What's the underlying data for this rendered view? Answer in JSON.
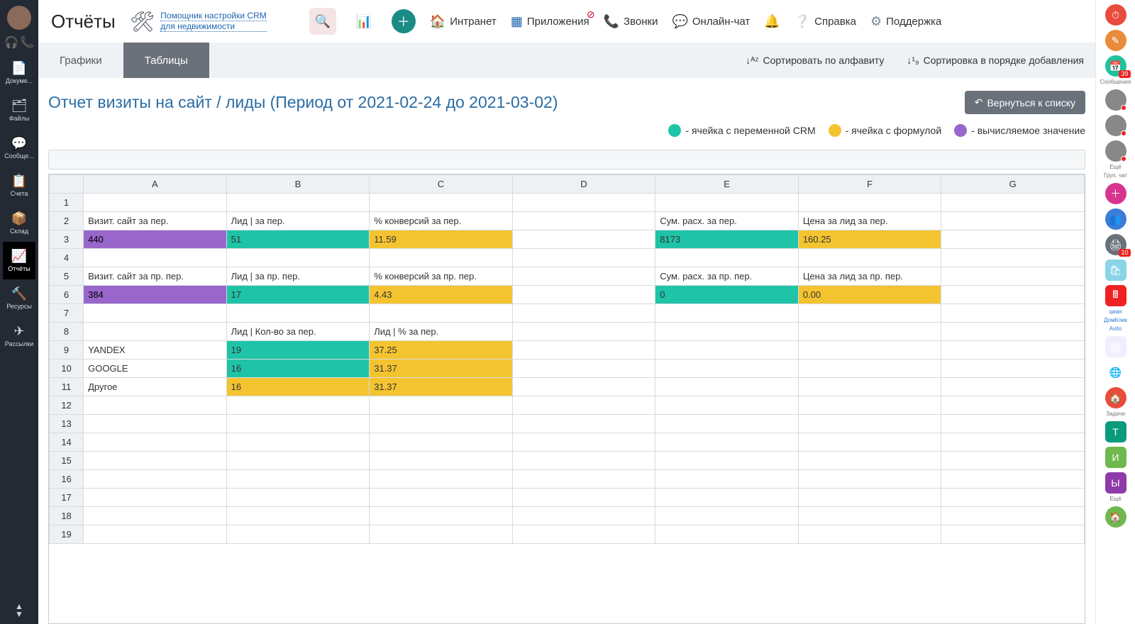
{
  "leftRail": {
    "items": [
      {
        "icon": "📄",
        "label": "Докуме..."
      },
      {
        "icon": "🗂",
        "label": "Файлы"
      },
      {
        "icon": "💬",
        "label": "Сообще..."
      },
      {
        "icon": "📋",
        "label": "Счета"
      },
      {
        "icon": "📦",
        "label": "Склад"
      },
      {
        "icon": "📈",
        "label": "Отчёты"
      },
      {
        "icon": "🔨",
        "label": "Ресурсы"
      },
      {
        "icon": "✈",
        "label": "Рассылки"
      }
    ],
    "activeIndex": 5
  },
  "header": {
    "pageTitle": "Отчёты",
    "crmHelperLine1": "Помощник настройки CRM",
    "crmHelperLine2": "для недвижимости",
    "nav": {
      "intranet": "Интранет",
      "apps": "Приложения",
      "calls": "Звонки",
      "chat": "Онлайн-чат",
      "help": "Справка",
      "support": "Поддержка"
    }
  },
  "subbar": {
    "tabs": [
      "Графики",
      "Таблицы"
    ],
    "activeIndex": 1,
    "sortAlpha": "Сортировать по алфавиту",
    "sortAdded": "Сортировка в порядке добавления"
  },
  "report": {
    "title": "Отчет визиты на сайт / лиды (Период от 2021-02-24 до 2021-03-02)",
    "backBtn": "Вернуться к списку"
  },
  "legend": {
    "crmVar": "- ячейка с переменной CRM",
    "formula": "- ячейка с формулой",
    "computed": "- вычисляемое значение"
  },
  "sheet": {
    "columns": [
      "A",
      "B",
      "C",
      "D",
      "E",
      "F",
      "G"
    ],
    "rows": 19,
    "cells": {
      "2": {
        "A": {
          "v": "Визит. сайт за пер."
        },
        "B": {
          "v": "Лид | за пер."
        },
        "C": {
          "v": "% конверсий за пер."
        },
        "E": {
          "v": "Сум. расх. за пер."
        },
        "F": {
          "v": "Цена за лид за пер."
        }
      },
      "3": {
        "A": {
          "v": "440",
          "c": "purple"
        },
        "B": {
          "v": "51",
          "c": "teal"
        },
        "C": {
          "v": "11.59",
          "c": "amber"
        },
        "E": {
          "v": "8173",
          "c": "teal"
        },
        "F": {
          "v": "160.25",
          "c": "amber"
        }
      },
      "5": {
        "A": {
          "v": "Визит. сайт за пр. пер."
        },
        "B": {
          "v": "Лид | за пр. пер."
        },
        "C": {
          "v": "% конверсий за пр. пер."
        },
        "E": {
          "v": "Сум. расх. за пр. пер."
        },
        "F": {
          "v": "Цена за лид за пр. пер."
        }
      },
      "6": {
        "A": {
          "v": "384",
          "c": "purple"
        },
        "B": {
          "v": "17",
          "c": "teal"
        },
        "C": {
          "v": "4.43",
          "c": "amber"
        },
        "E": {
          "v": "0",
          "c": "teal"
        },
        "F": {
          "v": "0.00",
          "c": "amber"
        }
      },
      "8": {
        "B": {
          "v": "Лид | Кол-во за пер."
        },
        "C": {
          "v": "Лид | % за пер."
        }
      },
      "9": {
        "A": {
          "v": "YANDEX"
        },
        "B": {
          "v": "19",
          "c": "teal"
        },
        "C": {
          "v": "37.25",
          "c": "amber"
        }
      },
      "10": {
        "A": {
          "v": "GOOGLE"
        },
        "B": {
          "v": "16",
          "c": "teal"
        },
        "C": {
          "v": "31.37",
          "c": "amber"
        }
      },
      "11": {
        "A": {
          "v": "Другое"
        },
        "B": {
          "v": "16",
          "c": "amber"
        },
        "C": {
          "v": "31.37",
          "c": "amber"
        }
      }
    },
    "selected": "A1"
  },
  "rightRail": {
    "buttons": [
      {
        "bg": "#e94b3c",
        "ic": "⏱"
      },
      {
        "bg": "#e98b3c",
        "ic": "✎"
      },
      {
        "bg": "#21c19d",
        "ic": "📅",
        "badge": "39",
        "lbl": "Сообщения"
      },
      {
        "avatar": true,
        "dot": true
      },
      {
        "avatar": true,
        "dot": true
      },
      {
        "avatar": true,
        "dot": true,
        "lbl": "Ещё"
      },
      {
        "lblOnly": "Груп. чат"
      },
      {
        "bg": "#d8338f",
        "ic": "＋"
      },
      {
        "bg": "#3b7dd8",
        "ic": "👥"
      },
      {
        "bg": "#6a717a",
        "ic": "🖨",
        "badge": "10"
      },
      {
        "bg": "#8bd4e8",
        "ic": "🛍",
        "sq": true
      },
      {
        "bg": "#e22",
        "ic": "🖩",
        "sq": true
      },
      {
        "logos": [
          "циан",
          "ДомКлик",
          "Avito"
        ]
      },
      {
        "bg": "#eef",
        "ic": "🏛",
        "sq": true
      },
      {
        "bg": "#fff",
        "ic": "🌐",
        "sq": true
      },
      {
        "bg": "#e94b3c",
        "ic": "🏠",
        "lbl": "Задачи"
      },
      {
        "bg": "#0a9b7d",
        "ic": "Т",
        "sq": true
      },
      {
        "bg": "#6fb84e",
        "ic": "И",
        "sq": true
      },
      {
        "bg": "#8e3aa8",
        "ic": "Ы",
        "sq": true,
        "lbl": "Ещё"
      },
      {
        "bg": "#6fb84e",
        "ic": "🏠"
      }
    ]
  }
}
